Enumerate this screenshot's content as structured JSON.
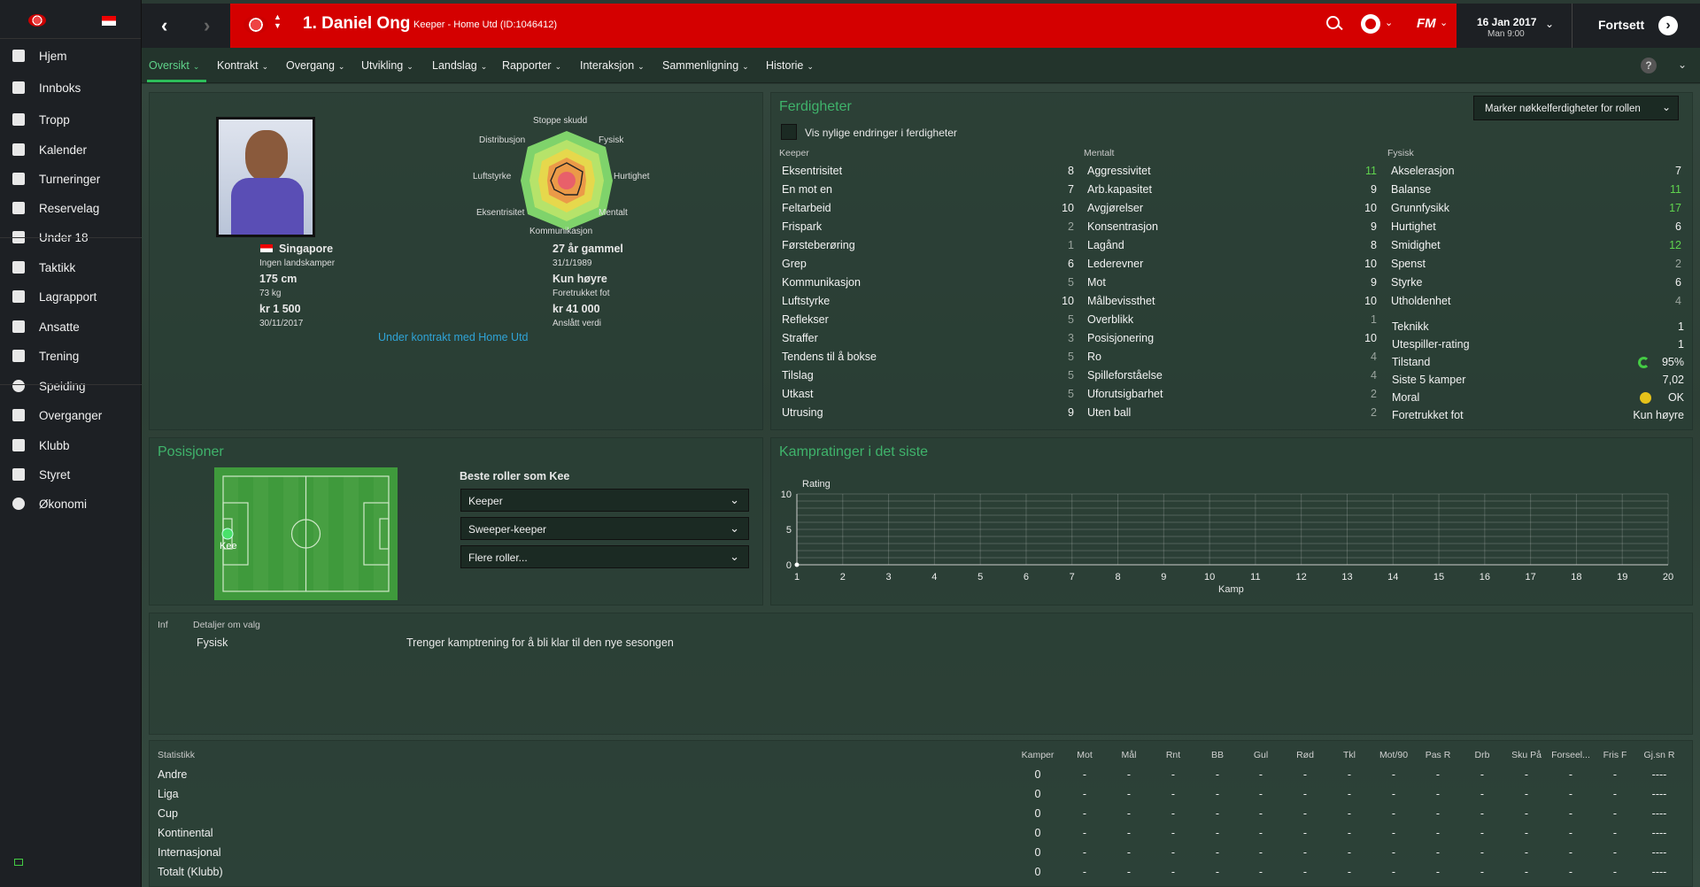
{
  "header": {
    "player_name": "1. Daniel Ong",
    "player_sub": "Keeper - Home Utd (ID:1046412)",
    "date": "16 Jan 2017",
    "day_time": "Man 9:00",
    "continue_label": "Fortsett",
    "fm_logo": "FM"
  },
  "sidebar": {
    "items": [
      {
        "label": "Hjem",
        "icon": "home-icon"
      },
      {
        "label": "Innboks",
        "icon": "inbox-icon"
      },
      {
        "label": "Tropp",
        "icon": "squad-icon"
      },
      {
        "label": "Kalender",
        "icon": "calendar-icon"
      },
      {
        "label": "Turneringer",
        "icon": "trophy-icon"
      },
      {
        "label": "Reservelag",
        "icon": "reserve-icon"
      },
      {
        "label": "Under 18",
        "icon": "u18-icon"
      },
      {
        "label": "Taktikk",
        "icon": "tactics-icon"
      },
      {
        "label": "Lagrapport",
        "icon": "report-icon"
      },
      {
        "label": "Ansatte",
        "icon": "staff-icon"
      },
      {
        "label": "Trening",
        "icon": "training-icon"
      },
      {
        "label": "Speiding",
        "icon": "search-icon"
      },
      {
        "label": "Overganger",
        "icon": "transfer-icon"
      },
      {
        "label": "Klubb",
        "icon": "shield-icon"
      },
      {
        "label": "Styret",
        "icon": "board-icon"
      },
      {
        "label": "Økonomi",
        "icon": "finance-icon"
      }
    ]
  },
  "tabs": [
    "Oversikt",
    "Kontrakt",
    "Overgang",
    "Utvikling",
    "Landslag",
    "Rapporter",
    "Interaksjon",
    "Sammenligning",
    "Historie"
  ],
  "overview": {
    "nationality": "Singapore",
    "caps": "Ingen landskamper",
    "height": "175 cm",
    "weight": "73 kg",
    "wage": "kr 1 500",
    "wage_date": "30/11/2017",
    "age": "27 år gammel",
    "dob": "31/1/1989",
    "foot": "Kun høyre",
    "foot_label": "Foretrukket fot",
    "value": "kr 41 000",
    "value_label": "Anslått verdi",
    "contract": "Under kontrakt med Home Utd",
    "radar_labels": {
      "top": "Stoppe skudd",
      "tl": "Distribusjon",
      "tr": "Fysisk",
      "ml": "Luftstyrke",
      "mr": "Hurtighet",
      "bl": "Eksentrisitet",
      "br": "Mentalt",
      "bottom": "Kommunikasjon"
    }
  },
  "attributes": {
    "title": "Ferdigheter",
    "button": "Marker nøkkelferdigheter for rollen",
    "checkbox": "Vis nylige endringer i ferdigheter",
    "keeper_header": "Keeper",
    "mental_header": "Mentalt",
    "physical_header": "Fysisk",
    "keeper": [
      {
        "name": "Eksentrisitet",
        "value": "8",
        "c": "w"
      },
      {
        "name": "En mot en",
        "value": "7",
        "c": "w"
      },
      {
        "name": "Feltarbeid",
        "value": "10",
        "c": "w"
      },
      {
        "name": "Frispark",
        "value": "2",
        "c": "g"
      },
      {
        "name": "Førsteberøring",
        "value": "1",
        "c": "g"
      },
      {
        "name": "Grep",
        "value": "6",
        "c": "w"
      },
      {
        "name": "Kommunikasjon",
        "value": "5",
        "c": "g"
      },
      {
        "name": "Luftstyrke",
        "value": "10",
        "c": "w"
      },
      {
        "name": "Reflekser",
        "value": "5",
        "c": "g"
      },
      {
        "name": "Straffer",
        "value": "3",
        "c": "g"
      },
      {
        "name": "Tendens til å bokse",
        "value": "5",
        "c": "g"
      },
      {
        "name": "Tilslag",
        "value": "5",
        "c": "g"
      },
      {
        "name": "Utkast",
        "value": "5",
        "c": "g"
      },
      {
        "name": "Utrusing",
        "value": "9",
        "c": "w"
      }
    ],
    "mental": [
      {
        "name": "Aggressivitet",
        "value": "11",
        "c": "gr"
      },
      {
        "name": "Arb.kapasitet",
        "value": "9",
        "c": "w"
      },
      {
        "name": "Avgjørelser",
        "value": "10",
        "c": "w"
      },
      {
        "name": "Konsentrasjon",
        "value": "9",
        "c": "w"
      },
      {
        "name": "Lagånd",
        "value": "8",
        "c": "w"
      },
      {
        "name": "Lederevner",
        "value": "10",
        "c": "w"
      },
      {
        "name": "Mot",
        "value": "9",
        "c": "w"
      },
      {
        "name": "Målbevissthet",
        "value": "10",
        "c": "w"
      },
      {
        "name": "Overblikk",
        "value": "1",
        "c": "g"
      },
      {
        "name": "Posisjonering",
        "value": "10",
        "c": "w"
      },
      {
        "name": "Ro",
        "value": "4",
        "c": "g"
      },
      {
        "name": "Spilleforståelse",
        "value": "4",
        "c": "g"
      },
      {
        "name": "Uforutsigbarhet",
        "value": "2",
        "c": "g"
      },
      {
        "name": "Uten ball",
        "value": "2",
        "c": "g"
      }
    ],
    "physical": [
      {
        "name": "Akselerasjon",
        "value": "7",
        "c": "w"
      },
      {
        "name": "Balanse",
        "value": "11",
        "c": "gr"
      },
      {
        "name": "Grunnfysikk",
        "value": "17",
        "c": "gr"
      },
      {
        "name": "Hurtighet",
        "value": "6",
        "c": "w"
      },
      {
        "name": "Smidighet",
        "value": "12",
        "c": "gr"
      },
      {
        "name": "Spenst",
        "value": "2",
        "c": "g"
      },
      {
        "name": "Styrke",
        "value": "6",
        "c": "w"
      },
      {
        "name": "Utholdenhet",
        "value": "4",
        "c": "g"
      }
    ],
    "extra": [
      {
        "name": "Teknikk",
        "value": "1"
      },
      {
        "name": "Utespiller-rating",
        "value": "1"
      },
      {
        "name": "Tilstand",
        "value": "95%"
      },
      {
        "name": "Siste 5 kamper",
        "value": "7,02"
      },
      {
        "name": "Moral",
        "value": "OK"
      },
      {
        "name": "Foretrukket fot",
        "value": "Kun høyre"
      }
    ]
  },
  "positions": {
    "title": "Posisjoner",
    "marker": "Kee",
    "roles_title": "Beste roller som Kee",
    "roles": [
      "Keeper",
      "Sweeper-keeper",
      "Flere roller..."
    ]
  },
  "ratings_chart": {
    "title": "Kampratinger i det siste"
  },
  "chart_data": {
    "type": "line",
    "title": "",
    "ylabel": "Rating",
    "xlabel": "Kamp",
    "x": [
      1,
      2,
      3,
      4,
      5,
      6,
      7,
      8,
      9,
      10,
      11,
      12,
      13,
      14,
      15,
      16,
      17,
      18,
      19,
      20
    ],
    "ylim": [
      0,
      10
    ],
    "yticks": [
      0,
      5,
      10
    ],
    "series": [
      {
        "values": [
          0
        ]
      }
    ]
  },
  "injury": {
    "col1": "Inf",
    "col2": "Detaljer om valg",
    "row_type": "Fysisk",
    "row_text": "Trenger kamptrening for å bli klar til den nye sesongen"
  },
  "stats": {
    "title": "Statistikk",
    "columns": [
      "Kamper",
      "Mot",
      "Mål",
      "Rnt",
      "BB",
      "Gul",
      "Rød",
      "Tkl",
      "Mot/90",
      "Pas R",
      "Drb",
      "Sku På",
      "Forseel...",
      "Fris F",
      "Gj.sn R"
    ],
    "rows": [
      {
        "name": "Andre",
        "cells": [
          "0",
          "-",
          "-",
          "-",
          "-",
          "-",
          "-",
          "-",
          "-",
          "-",
          "-",
          "-",
          "-",
          "-",
          "----"
        ]
      },
      {
        "name": "Liga",
        "cells": [
          "0",
          "-",
          "-",
          "-",
          "-",
          "-",
          "-",
          "-",
          "-",
          "-",
          "-",
          "-",
          "-",
          "-",
          "----"
        ]
      },
      {
        "name": "Cup",
        "cells": [
          "0",
          "-",
          "-",
          "-",
          "-",
          "-",
          "-",
          "-",
          "-",
          "-",
          "-",
          "-",
          "-",
          "-",
          "----"
        ]
      },
      {
        "name": "Kontinental",
        "cells": [
          "0",
          "-",
          "-",
          "-",
          "-",
          "-",
          "-",
          "-",
          "-",
          "-",
          "-",
          "-",
          "-",
          "-",
          "----"
        ]
      },
      {
        "name": "Internasjonal",
        "cells": [
          "0",
          "-",
          "-",
          "-",
          "-",
          "-",
          "-",
          "-",
          "-",
          "-",
          "-",
          "-",
          "-",
          "-",
          "----"
        ]
      },
      {
        "name": "Totalt (Klubb)",
        "cells": [
          "0",
          "-",
          "-",
          "-",
          "-",
          "-",
          "-",
          "-",
          "-",
          "-",
          "-",
          "-",
          "-",
          "-",
          "----"
        ]
      }
    ]
  },
  "colors": {
    "accent_green": "#3fb36b",
    "header_red": "#d40000",
    "sidebar": "#1d2024"
  }
}
